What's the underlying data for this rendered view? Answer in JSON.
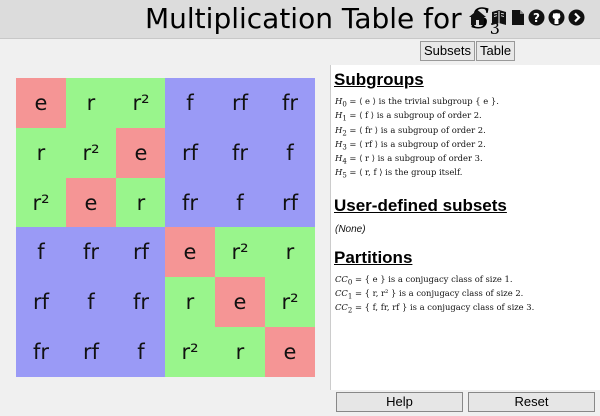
{
  "header": {
    "title_prefix": "Multiplication Table for ",
    "group_letter": "S",
    "group_sub": "3",
    "icons": [
      "home-icon",
      "book-icon",
      "document-icon",
      "help-icon",
      "github-icon",
      "next-icon"
    ]
  },
  "colors": {
    "identity": "#f59595",
    "rotation": "#99f58c",
    "reflection": "#9a9af6"
  },
  "table": {
    "rows": [
      [
        "e",
        "r",
        "r²",
        "f",
        "rf",
        "fr"
      ],
      [
        "r",
        "r²",
        "e",
        "rf",
        "fr",
        "f"
      ],
      [
        "r²",
        "e",
        "r",
        "fr",
        "f",
        "rf"
      ],
      [
        "f",
        "fr",
        "rf",
        "e",
        "r²",
        "r"
      ],
      [
        "rf",
        "f",
        "fr",
        "r",
        "e",
        "r²"
      ],
      [
        "fr",
        "rf",
        "f",
        "r²",
        "r",
        "e"
      ]
    ]
  },
  "tabs": {
    "subsets": "Subsets",
    "table": "Table"
  },
  "subgroups": {
    "heading": "Subgroups",
    "items": [
      {
        "name": "H",
        "idx": "0",
        "body": " = ⟨ e ⟩ is the trivial subgroup { e }."
      },
      {
        "name": "H",
        "idx": "1",
        "body": " = ⟨ f ⟩ is a subgroup of order 2."
      },
      {
        "name": "H",
        "idx": "2",
        "body": " = ⟨ fr ⟩ is a subgroup of order 2."
      },
      {
        "name": "H",
        "idx": "3",
        "body": " = ⟨ rf ⟩ is a subgroup of order 2."
      },
      {
        "name": "H",
        "idx": "4",
        "body": " = ⟨ r ⟩ is a subgroup of order 3."
      },
      {
        "name": "H",
        "idx": "5",
        "body": " = ⟨ r, f ⟩ is the group itself."
      }
    ]
  },
  "user_subsets": {
    "heading": "User-defined subsets",
    "empty": "(None)"
  },
  "partitions": {
    "heading": "Partitions",
    "items": [
      {
        "name": "CC",
        "idx": "0",
        "body": " = { e } is a conjugacy class of size 1."
      },
      {
        "name": "CC",
        "idx": "1",
        "body": " = { r, r² } is a conjugacy class of size 2."
      },
      {
        "name": "CC",
        "idx": "2",
        "body": " = { f, fr, rf } is a conjugacy class of size 3."
      }
    ]
  },
  "buttons": {
    "help": "Help",
    "reset": "Reset"
  }
}
